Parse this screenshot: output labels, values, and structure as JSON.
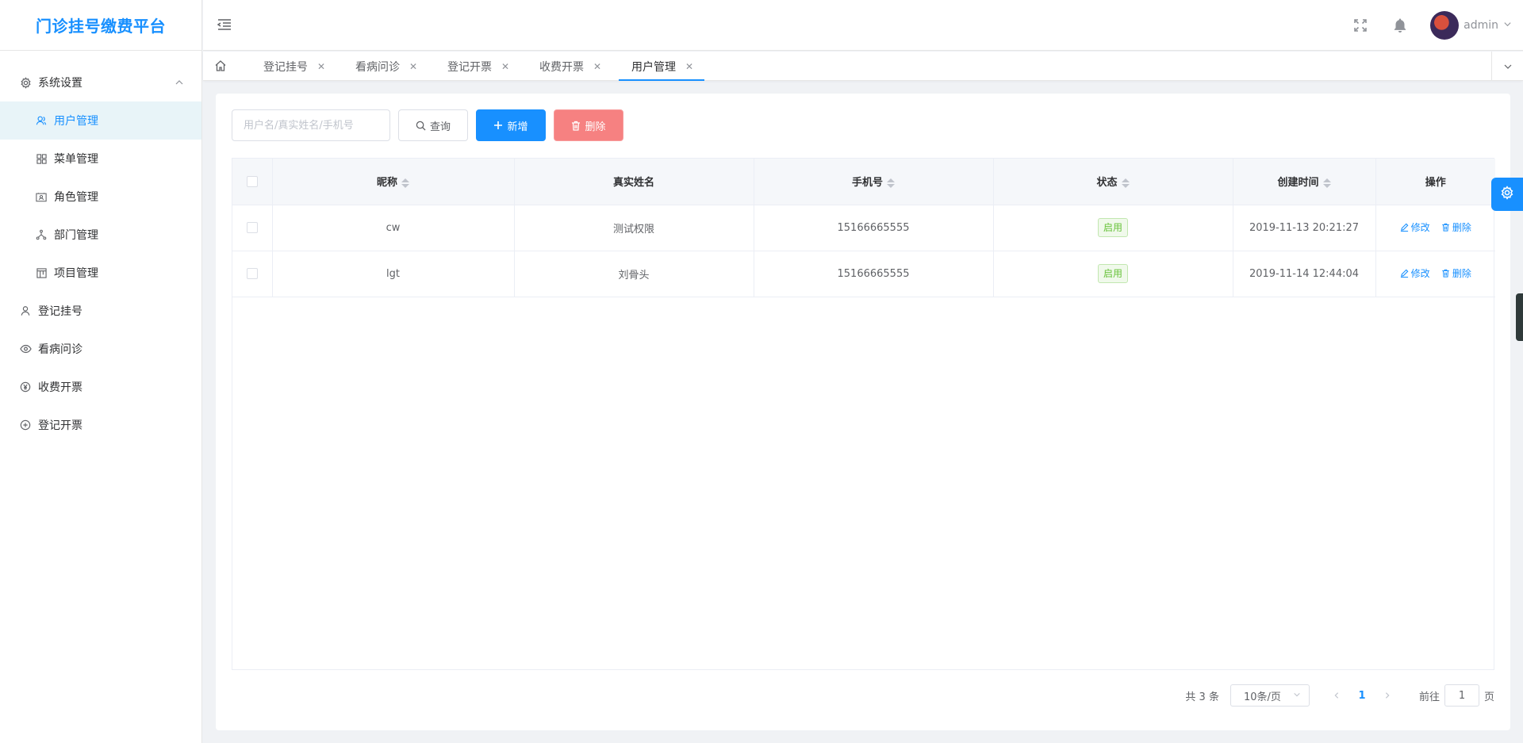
{
  "app": {
    "title": "门诊挂号缴费平台"
  },
  "sidebar": {
    "items": [
      {
        "label": "系统设置",
        "icon": "gear-icon",
        "level": 0,
        "expanded": true
      },
      {
        "label": "用户管理",
        "icon": "user-group-icon",
        "level": 1,
        "active": true
      },
      {
        "label": "菜单管理",
        "icon": "grid-icon",
        "level": 1
      },
      {
        "label": "角色管理",
        "icon": "id-card-icon",
        "level": 1
      },
      {
        "label": "部门管理",
        "icon": "org-icon",
        "level": 1
      },
      {
        "label": "项目管理",
        "icon": "board-icon",
        "level": 1
      },
      {
        "label": "登记挂号",
        "icon": "user-icon",
        "level": 0
      },
      {
        "label": "看病问诊",
        "icon": "eye-icon",
        "level": 0
      },
      {
        "label": "收费开票",
        "icon": "yen-icon",
        "level": 0
      },
      {
        "label": "登记开票",
        "icon": "plus-circle-icon",
        "level": 0
      }
    ]
  },
  "header": {
    "user_name": "admin"
  },
  "tabs": [
    {
      "label": "登记挂号"
    },
    {
      "label": "看病问诊"
    },
    {
      "label": "登记开票"
    },
    {
      "label": "收费开票"
    },
    {
      "label": "用户管理",
      "active": true
    }
  ],
  "toolbar": {
    "search_placeholder": "用户名/真实姓名/手机号",
    "query_label": "查询",
    "add_label": "新增",
    "delete_label": "删除"
  },
  "table": {
    "columns": [
      "昵称",
      "真实姓名",
      "手机号",
      "状态",
      "创建时间",
      "操作"
    ],
    "rows": [
      {
        "nickname": "cw",
        "real_name": "测试权限",
        "phone": "15166665555",
        "status": "启用",
        "created": "2019-11-13 20:21:27"
      },
      {
        "nickname": "lgt",
        "real_name": "刘骨头",
        "phone": "15166665555",
        "status": "启用",
        "created": "2019-11-14 12:44:04"
      }
    ],
    "edit_label": "修改",
    "delete_label": "删除"
  },
  "pagination": {
    "total_text": "共 3 条",
    "page_size": "10条/页",
    "current_page": "1",
    "goto_prefix": "前往",
    "goto_value": "1",
    "goto_suffix": "页"
  },
  "colors": {
    "primary": "#1890ff",
    "danger": "#f56c6c",
    "success": "#67c23a"
  }
}
